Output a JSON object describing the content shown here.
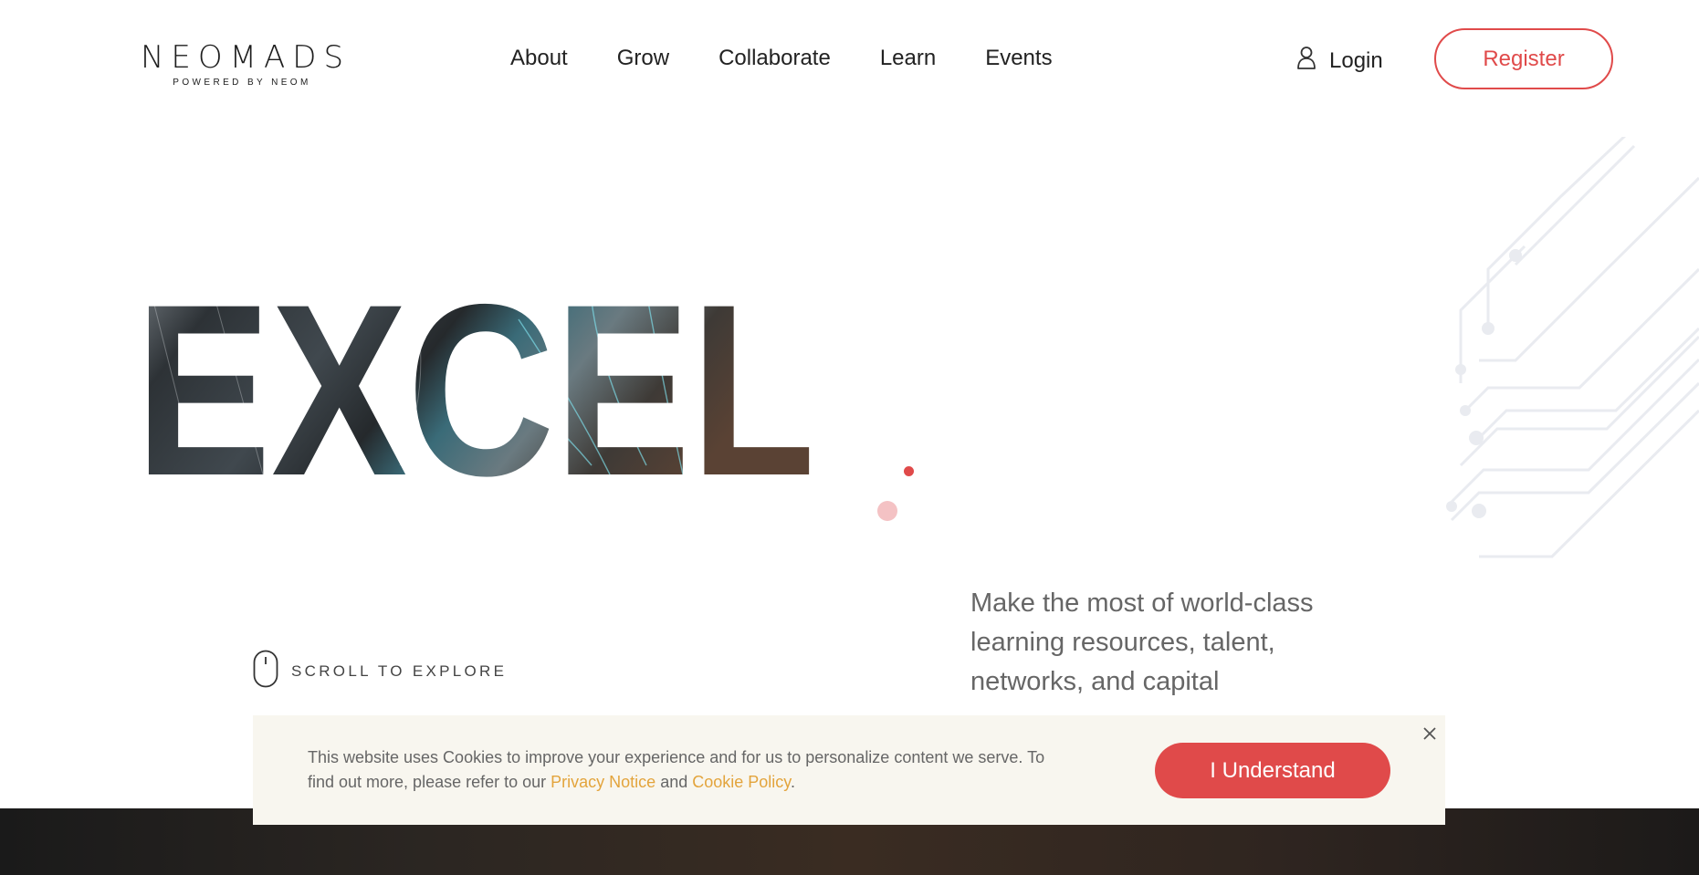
{
  "header": {
    "logo_main": "NEOMADS",
    "logo_sub": "POWERED BY NEOM",
    "nav": [
      "About",
      "Grow",
      "Collaborate",
      "Learn",
      "Events"
    ],
    "login_label": "Login",
    "register_label": "Register"
  },
  "hero": {
    "headline": "EXCEL",
    "tagline": "Make the most of world-class learning resources, talent, networks, and capital",
    "scroll_label": "SCROLL TO EXPLORE"
  },
  "cookie": {
    "text_before": "This website uses Cookies to improve your experience and for us to personalize content we serve. To find out more, please refer to our ",
    "privacy_link": "Privacy Notice",
    "and_text": " and ",
    "cookie_link": "Cookie Policy",
    "period": ".",
    "button_label": "I Understand",
    "close_icon": "close-icon"
  },
  "colors": {
    "accent": "#e04a4a",
    "link": "#e3a43c",
    "banner_bg": "#f8f6ef"
  }
}
